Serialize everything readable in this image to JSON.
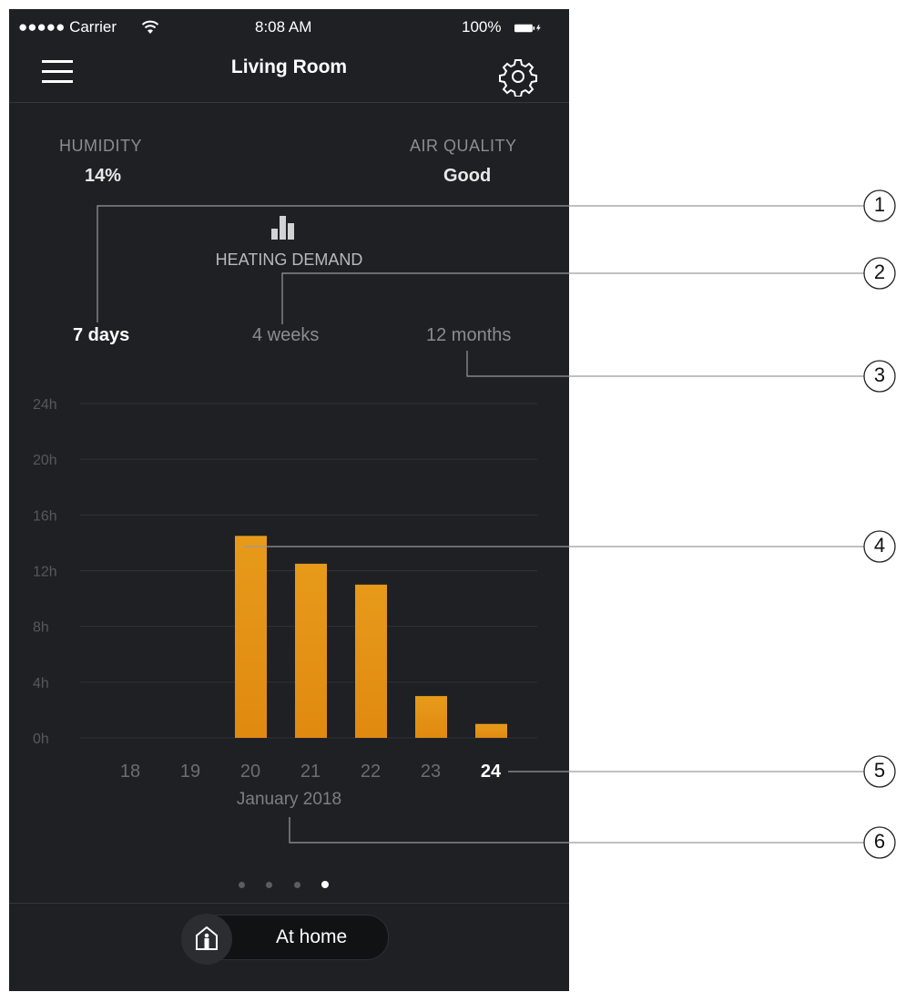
{
  "status_bar": {
    "carrier": "●●●●● Carrier",
    "time": "8:08 AM",
    "battery": "100%"
  },
  "nav": {
    "title": "Living Room",
    "menu_icon": "hamburger-menu-icon",
    "settings_icon": "gear-icon"
  },
  "stats": {
    "humidity": {
      "label": "HUMIDITY",
      "value": "14%"
    },
    "air_quality": {
      "label": "AIR QUALITY",
      "value": "Good"
    }
  },
  "section": {
    "label": "HEATING DEMAND",
    "icon": "bar-chart-icon"
  },
  "periods": [
    {
      "label": "7 days",
      "active": true
    },
    {
      "label": "4 weeks",
      "active": false
    },
    {
      "label": "12 months",
      "active": false
    }
  ],
  "chart_data": {
    "type": "bar",
    "categories": [
      "18",
      "19",
      "20",
      "21",
      "22",
      "23",
      "24"
    ],
    "values": [
      0,
      0,
      14.5,
      12.5,
      11,
      3,
      1
    ],
    "y_ticks": [
      "0h",
      "4h",
      "8h",
      "12h",
      "16h",
      "20h",
      "24h"
    ],
    "ylim": [
      0,
      24
    ],
    "xlabel": "January 2018",
    "highlighted_category": "24",
    "bar_color": "#e08a10"
  },
  "page_dots": {
    "count": 4,
    "active_index": 3
  },
  "mode": {
    "label": "At home",
    "icon": "house-person-icon"
  },
  "callouts": [
    "1",
    "2",
    "3",
    "4",
    "5",
    "6"
  ],
  "colors": {
    "background": "#1e2024",
    "accent": "#e08a10",
    "text": "#ffffff"
  }
}
